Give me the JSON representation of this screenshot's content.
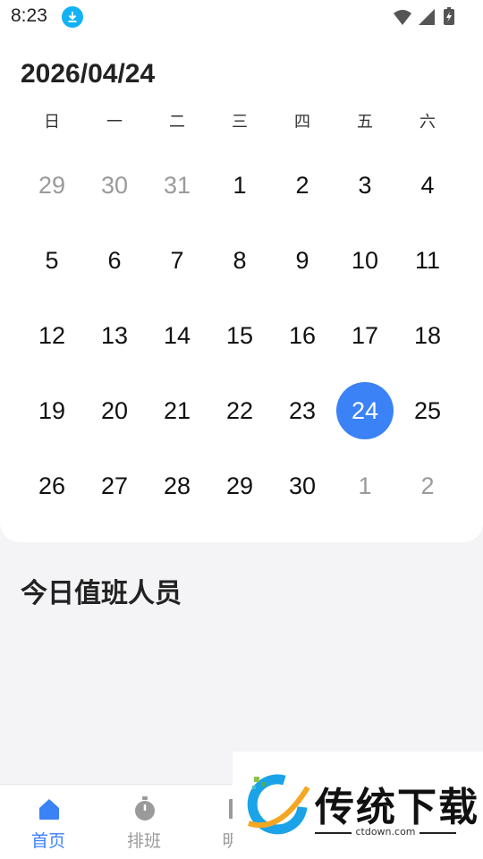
{
  "status_bar": {
    "time": "8:23"
  },
  "calendar": {
    "current_date": "2026/04/24",
    "weekdays": [
      "日",
      "一",
      "二",
      "三",
      "四",
      "五",
      "六"
    ],
    "weeks": [
      [
        {
          "d": "29",
          "dim": true
        },
        {
          "d": "30",
          "dim": true
        },
        {
          "d": "31",
          "dim": true
        },
        {
          "d": "1"
        },
        {
          "d": "2"
        },
        {
          "d": "3"
        },
        {
          "d": "4"
        }
      ],
      [
        {
          "d": "5"
        },
        {
          "d": "6"
        },
        {
          "d": "7"
        },
        {
          "d": "8"
        },
        {
          "d": "9"
        },
        {
          "d": "10"
        },
        {
          "d": "11"
        }
      ],
      [
        {
          "d": "12"
        },
        {
          "d": "13"
        },
        {
          "d": "14"
        },
        {
          "d": "15"
        },
        {
          "d": "16"
        },
        {
          "d": "17"
        },
        {
          "d": "18"
        }
      ],
      [
        {
          "d": "19"
        },
        {
          "d": "20"
        },
        {
          "d": "21"
        },
        {
          "d": "22"
        },
        {
          "d": "23"
        },
        {
          "d": "24",
          "sel": true
        },
        {
          "d": "25"
        }
      ],
      [
        {
          "d": "26"
        },
        {
          "d": "27"
        },
        {
          "d": "28"
        },
        {
          "d": "29"
        },
        {
          "d": "30"
        },
        {
          "d": "1",
          "dim": true
        },
        {
          "d": "2",
          "dim": true
        }
      ]
    ],
    "selected_color": "#3b82f6"
  },
  "section": {
    "title": "今日值班人员"
  },
  "nav": {
    "items": [
      {
        "label": "首页",
        "icon": "home-icon",
        "active": true
      },
      {
        "label": "排班",
        "icon": "stopwatch-icon",
        "active": false
      },
      {
        "label": "明",
        "icon": "schedule-icon",
        "active": false
      }
    ]
  },
  "watermark": {
    "title": "传统下载",
    "url": "ctdown.com"
  }
}
